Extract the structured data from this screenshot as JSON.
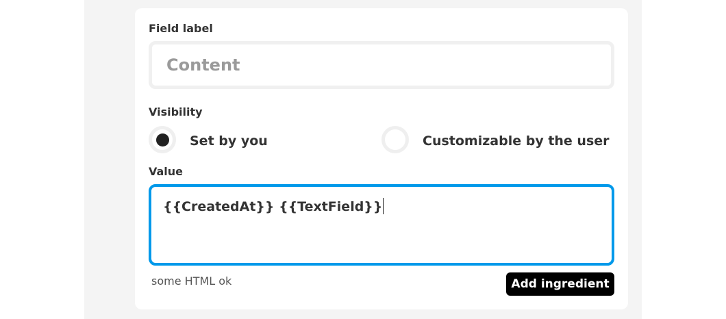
{
  "form": {
    "field_label_heading": "Field label",
    "field_label_placeholder": "Content",
    "visibility_heading": "Visibility",
    "visibility_options": [
      {
        "label": "Set by you",
        "selected": true
      },
      {
        "label": "Customizable by the user",
        "selected": false
      }
    ],
    "value_heading": "Value",
    "value_text": "{{CreatedAt}} {{TextField}}",
    "helper_text": "some HTML ok",
    "add_ingredient_label": "Add ingredient"
  },
  "colors": {
    "focus_border": "#0099ea",
    "button_bg": "#000000",
    "panel_bg": "#f4f4f4"
  }
}
